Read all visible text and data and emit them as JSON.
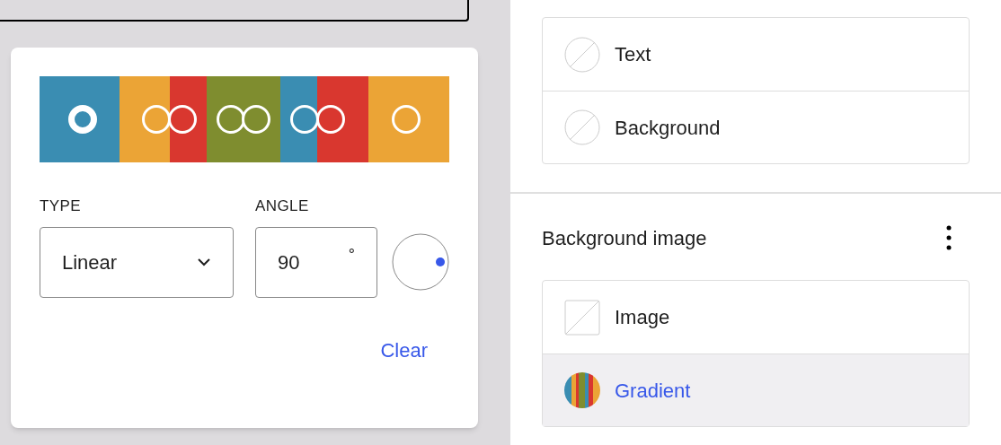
{
  "gradient_picker": {
    "stops": [
      {
        "color": "#3a8db2",
        "level": 0.105,
        "selected": true
      },
      {
        "color": "#eba436",
        "level": 0.285,
        "selected": false
      },
      {
        "color": "#d9372f",
        "level": 0.349,
        "selected": false
      },
      {
        "color": "#7f8d2f",
        "level": 0.467,
        "selected": false
      },
      {
        "color": "#7f8d2f",
        "level": 0.528,
        "selected": false
      },
      {
        "color": "#3a8db2",
        "level": 0.647,
        "selected": false
      },
      {
        "color": "#d9372f",
        "level": 0.71,
        "selected": false
      },
      {
        "color": "#eba436",
        "level": 0.895,
        "selected": false
      }
    ],
    "type": {
      "label": "TYPE",
      "value": "Linear"
    },
    "angle": {
      "label": "ANGLE",
      "value": "90",
      "unit": "°"
    },
    "clear_button": "Clear"
  },
  "color_panel": {
    "items": [
      {
        "label": "Text",
        "selected": false
      },
      {
        "label": "Background",
        "selected": false
      }
    ]
  },
  "background_image": {
    "title": "Background image",
    "items": [
      {
        "label": "Image",
        "kind": "image",
        "selected": false
      },
      {
        "label": "Gradient",
        "kind": "gradient",
        "selected": true
      }
    ]
  }
}
